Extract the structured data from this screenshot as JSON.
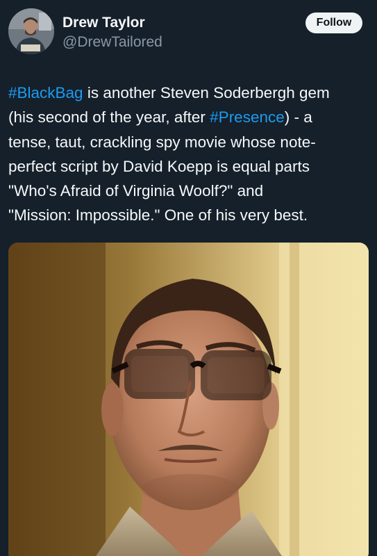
{
  "author": {
    "display_name": "Drew Taylor",
    "handle": "@DrewTailored",
    "avatar_icon": "profile-photo"
  },
  "follow_label": "Follow",
  "tweet": {
    "line1": {
      "hashtag": "#BlackBag",
      "text": " is another Steven Soderbergh gem"
    },
    "line2": {
      "before": "(his second of the year, after ",
      "hashtag": "#Presence",
      "after": ") - a"
    },
    "line3": "tense, taut, crackling spy movie whose note-",
    "line4": "perfect script by David Koepp is equal parts",
    "line5": "\"Who's Afraid of Virginia Woolf?\" and",
    "line6": "\"Mission: Impossible.\" One of his very best."
  },
  "media": {
    "type": "photo",
    "subject": "still-image"
  },
  "colors": {
    "background": "#15202b",
    "text": "#f7f9f9",
    "secondary_text": "#8b98a5",
    "link": "#1d9bf0",
    "follow_bg": "#eff3f4"
  }
}
